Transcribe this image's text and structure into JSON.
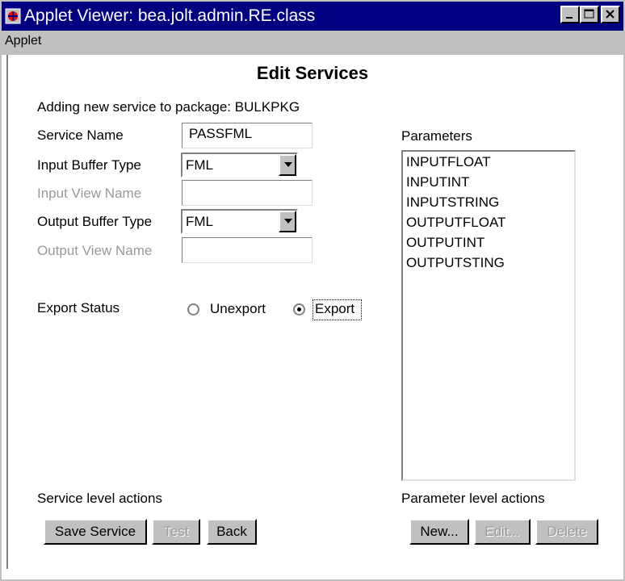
{
  "window": {
    "title": "Applet Viewer: bea.jolt.admin.RE.class",
    "controls": [
      "minimize-icon",
      "maximize-icon",
      "close-icon"
    ]
  },
  "menubar": {
    "items": [
      "Applet"
    ]
  },
  "page": {
    "heading": "Edit Services",
    "subtitle": "Adding new service to package: BULKPKG"
  },
  "form": {
    "service_name": {
      "label": "Service Name",
      "value": "PASSFML"
    },
    "input_buffer_type": {
      "label": "Input Buffer Type",
      "value": "FML"
    },
    "input_view_name": {
      "label": "Input View Name",
      "value": ""
    },
    "output_buffer_type": {
      "label": "Output Buffer Type",
      "value": "FML"
    },
    "output_view_name": {
      "label": "Output View Name",
      "value": ""
    },
    "export_status": {
      "label": "Export Status",
      "options": [
        "Unexport",
        "Export"
      ],
      "selected": "Export"
    }
  },
  "parameters": {
    "label": "Parameters",
    "items": [
      "INPUTFLOAT",
      "INPUTINT",
      "INPUTSTRING",
      "OUTPUTFLOAT",
      "OUTPUTINT",
      "OUTPUTSTING"
    ]
  },
  "service_actions": {
    "label": "Service level actions",
    "save": "Save Service",
    "test": "Test",
    "back": "Back"
  },
  "parameter_actions": {
    "label": "Parameter level actions",
    "new": "New...",
    "edit": "Edit...",
    "delete": "Delete"
  }
}
